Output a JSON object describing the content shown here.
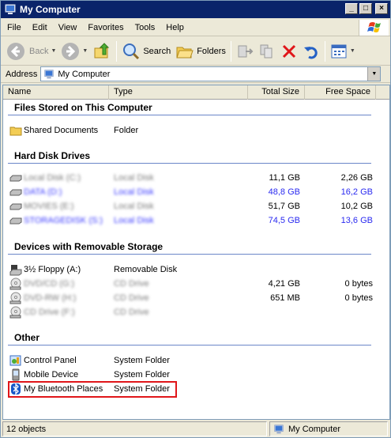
{
  "window": {
    "title": "My Computer"
  },
  "menu": {
    "items": [
      {
        "label": "File"
      },
      {
        "label": "Edit"
      },
      {
        "label": "View"
      },
      {
        "label": "Favorites"
      },
      {
        "label": "Tools"
      },
      {
        "label": "Help"
      }
    ]
  },
  "toolbar": {
    "back_label": "Back",
    "search_label": "Search",
    "folders_label": "Folders"
  },
  "address": {
    "label": "Address",
    "value": "My Computer"
  },
  "columns": {
    "name": "Name",
    "type": "Type",
    "total": "Total Size",
    "free": "Free Space"
  },
  "groups": {
    "files_stored": "Files Stored on This Computer",
    "hard_disks": "Hard Disk Drives",
    "removable": "Devices with Removable Storage",
    "other": "Other"
  },
  "items": {
    "shared": {
      "name": "Shared Documents",
      "type": "Folder"
    },
    "disk1": {
      "name": "Local Disk (C:)",
      "type": "Local Disk",
      "total": "11,1 GB",
      "free": "2,26 GB"
    },
    "disk2": {
      "name": "DATA (D:)",
      "type": "Local Disk",
      "total": "48,8 GB",
      "free": "16,2 GB"
    },
    "disk3": {
      "name": "MOVIES (E:)",
      "type": "Local Disk",
      "total": "51,7 GB",
      "free": "10,2 GB"
    },
    "disk4": {
      "name": "STORAGEDISK (S:)",
      "type": "Local Disk",
      "total": "74,5 GB",
      "free": "13,6 GB"
    },
    "floppy": {
      "name": "3½ Floppy (A:)",
      "type": "Removable Disk"
    },
    "cd1": {
      "name": "DVD/CD (G:)",
      "type": "CD Drive",
      "total": "4,21 GB",
      "free": "0 bytes"
    },
    "cd2": {
      "name": "DVD-RW (H:)",
      "type": "CD Drive",
      "total": "651 MB",
      "free": "0 bytes"
    },
    "cd3": {
      "name": "CD Drive (F:)",
      "type": "CD Drive"
    },
    "control": {
      "name": "Control Panel",
      "type": "System Folder"
    },
    "mobile": {
      "name": "Mobile Device",
      "type": "System Folder"
    },
    "bluetooth": {
      "name": "My Bluetooth Places",
      "type": "System Folder"
    }
  },
  "status": {
    "count": "12 objects",
    "location": "My Computer"
  }
}
